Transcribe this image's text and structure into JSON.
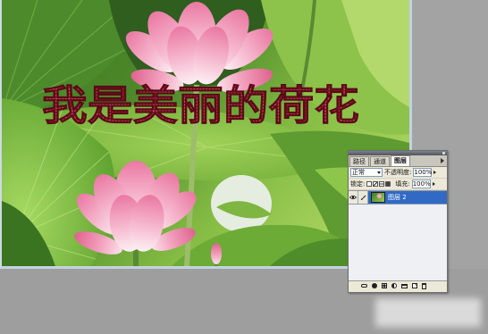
{
  "overlay": {
    "text": "我是美丽的荷花",
    "fill_color": "#7a1424",
    "dot_color": "#d04a5f"
  },
  "layers_panel": {
    "tabs": [
      {
        "label": "路径",
        "active": false
      },
      {
        "label": "通道",
        "active": false
      },
      {
        "label": "图层",
        "active": true
      }
    ],
    "blend_mode": "正常",
    "opacity_label": "不透明度:",
    "opacity_value": "100%",
    "lock_label": "锁定:",
    "lock_icons": [
      "lock-transparency-icon",
      "lock-pixels-icon",
      "lock-position-icon",
      "lock-all-icon"
    ],
    "fill_label": "填充:",
    "fill_value": "100%",
    "layers": [
      {
        "name": "图层 2",
        "visible": true,
        "selected": true
      }
    ],
    "bottom_icons": [
      "link-layers-icon",
      "layer-style-icon",
      "layer-mask-icon",
      "adjustment-layer-icon",
      "layer-group-icon",
      "new-layer-icon",
      "delete-layer-icon"
    ],
    "selected_layer_color": "#316ac5"
  }
}
